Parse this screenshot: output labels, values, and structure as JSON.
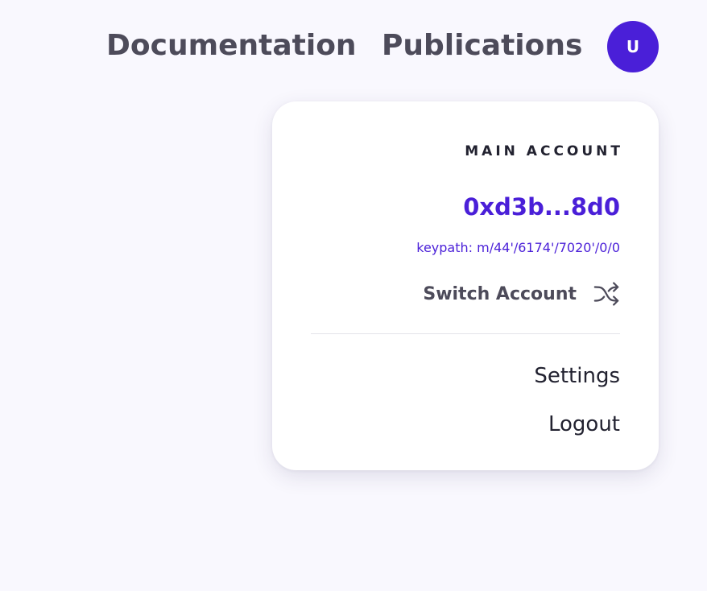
{
  "nav": {
    "documentation_label": "Documentation",
    "publications_label": "Publications"
  },
  "avatar": {
    "initial": "U",
    "color": "#4a1fd8"
  },
  "account_menu": {
    "heading": "MAIN ACCOUNT",
    "address": "0xd3b...8d0",
    "keypath": "keypath: m/44'/6174'/7020'/0/0",
    "switch_label": "Switch Account",
    "switch_icon": "shuffle-icon",
    "items": [
      {
        "label": "Settings"
      },
      {
        "label": "Logout"
      }
    ]
  },
  "colors": {
    "accent": "#4a1fd8",
    "background": "#f9f8fe",
    "text_dark": "#222230",
    "text_muted": "#4d4b5a"
  }
}
